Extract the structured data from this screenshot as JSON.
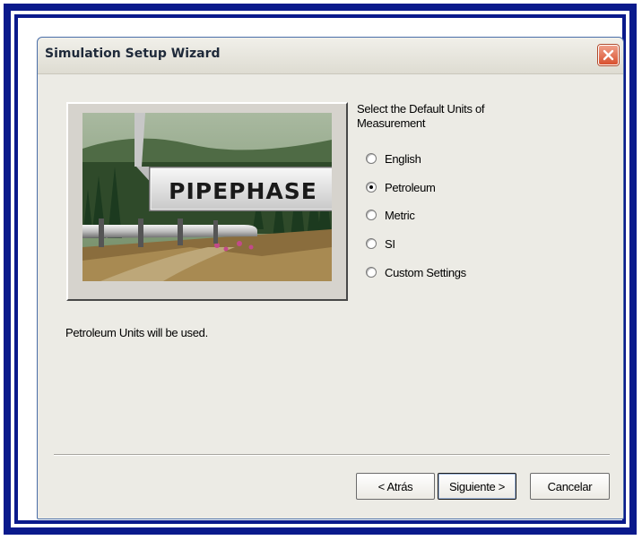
{
  "window": {
    "title": "Simulation Setup Wizard"
  },
  "logo_text": "PIPEPHASE",
  "units": {
    "prompt": "Select the Default Units of Measurement",
    "options": [
      {
        "label": "English",
        "checked": false
      },
      {
        "label": "Petroleum",
        "checked": true
      },
      {
        "label": "Metric",
        "checked": false
      },
      {
        "label": "SI",
        "checked": false
      },
      {
        "label": "Custom Settings",
        "checked": false
      }
    ]
  },
  "status": "Petroleum Units will be used.",
  "buttons": {
    "back": "< Atrás",
    "next": "Siguiente >",
    "cancel": "Cancelar"
  },
  "colors": {
    "outer_frame": "#0a1a8c",
    "dialog_bg": "#ecebe5",
    "close_button": "#d8512f"
  },
  "icons": {
    "close": "close-icon"
  }
}
